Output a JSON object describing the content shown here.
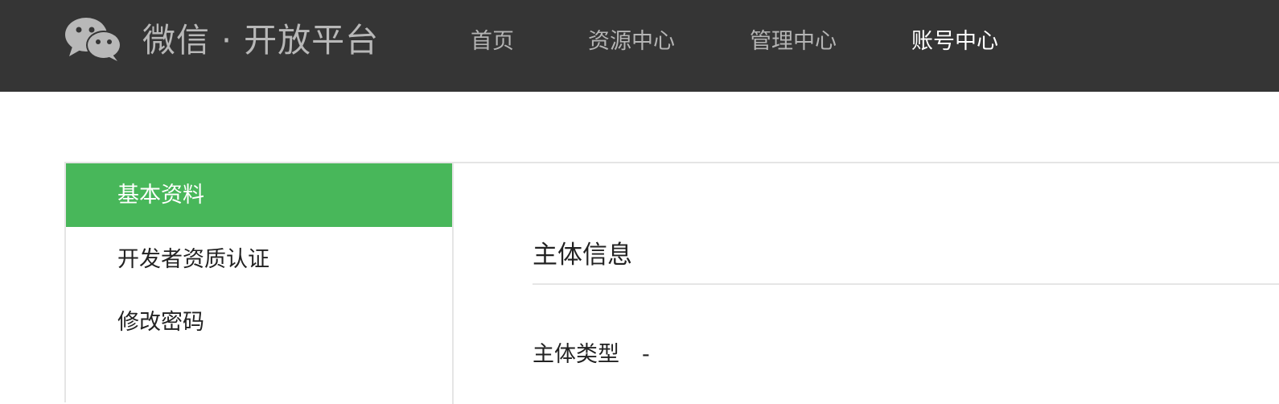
{
  "header": {
    "brand": "微信 · 开放平台",
    "logo_icon": "wechat-logo-icon",
    "nav": [
      {
        "label": "首页",
        "active": false
      },
      {
        "label": "资源中心",
        "active": false
      },
      {
        "label": "管理中心",
        "active": false
      },
      {
        "label": "账号中心",
        "active": true
      }
    ]
  },
  "sidebar": {
    "items": [
      {
        "label": "基本资料",
        "active": true
      },
      {
        "label": "开发者资质认证",
        "active": false
      },
      {
        "label": "修改密码",
        "active": false
      }
    ]
  },
  "main": {
    "section_title": "主体信息",
    "fields": [
      {
        "label": "主体类型",
        "value": "-"
      }
    ]
  },
  "colors": {
    "topbar": "#353535",
    "accent": "#48b75a",
    "border": "#e5e5e5"
  }
}
